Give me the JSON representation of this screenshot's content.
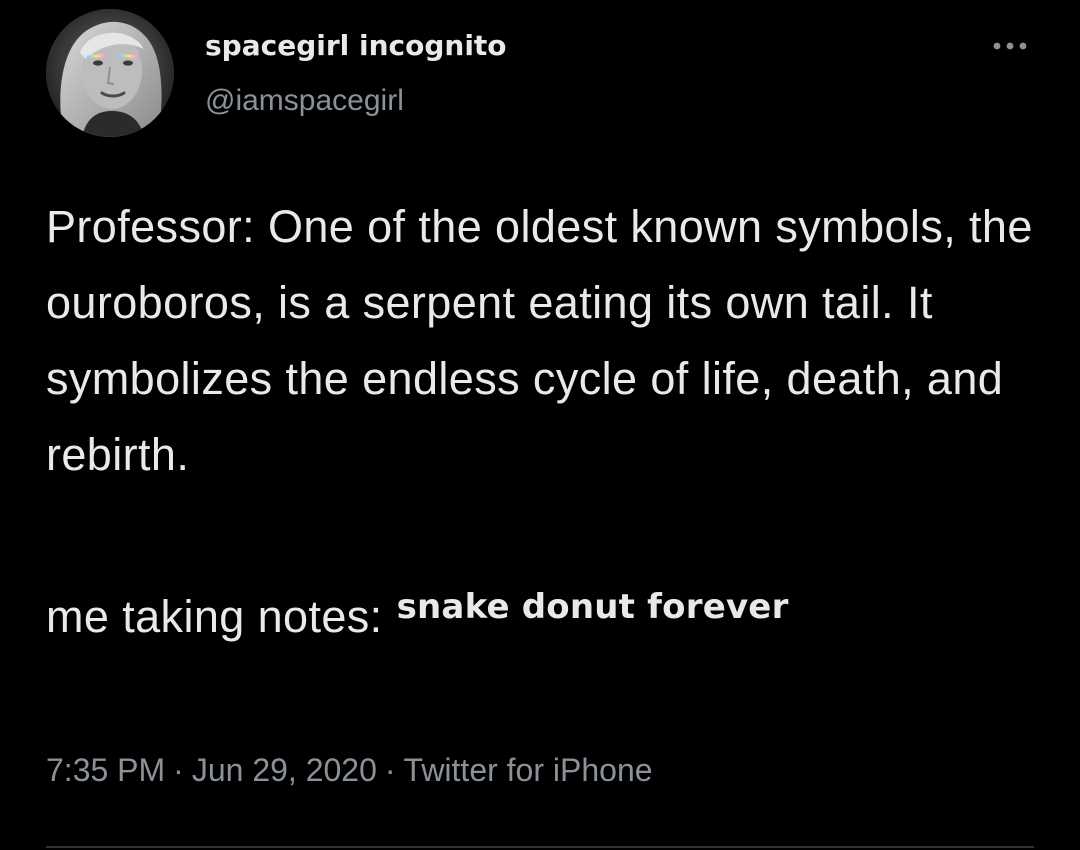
{
  "author": {
    "display_name": "spacegirl incognito",
    "handle": "@iamspacegirl",
    "avatar_icon": "profile-photo"
  },
  "more_icon": "more-horizontal-icon",
  "tweet": {
    "paragraph_1": "Professor: One of the oldest known symbols, the ouroboros, is a serpent eating its own tail. It symbolizes the endless cycle of life, death, and rebirth.",
    "notes_lead": "me taking notes:",
    "notes_small": "snake donut forever"
  },
  "meta": {
    "time": "7:35 PM",
    "date": "Jun 29, 2020",
    "separator": "·",
    "source": "Twitter for iPhone"
  },
  "colors": {
    "background": "#000000",
    "primary_text": "#e7e9ea",
    "secondary_text": "#8b9198",
    "divider": "#2f3336"
  }
}
